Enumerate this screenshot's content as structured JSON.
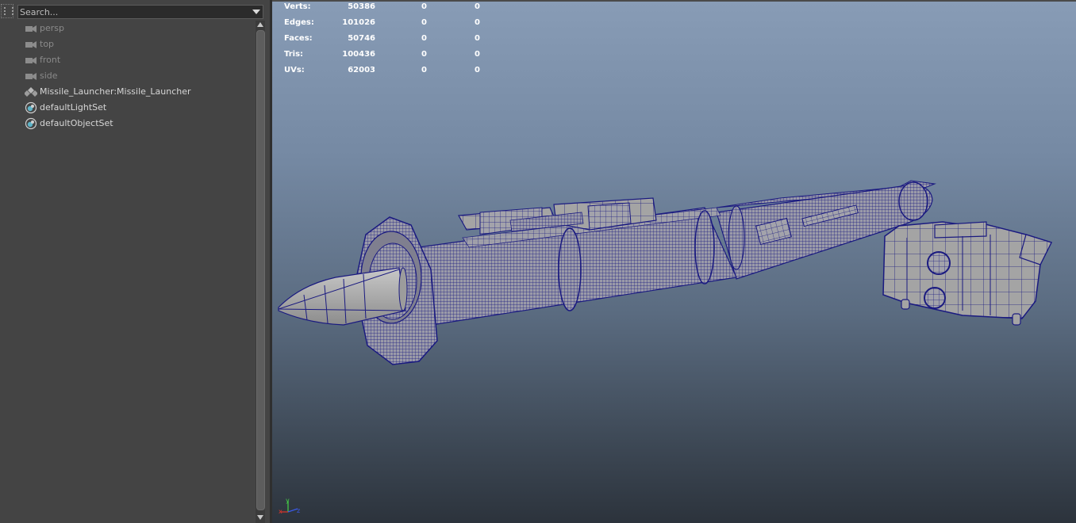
{
  "outliner": {
    "search_placeholder": "Search...",
    "items": [
      {
        "label": "persp",
        "icon": "camera-icon",
        "dim": true
      },
      {
        "label": "top",
        "icon": "camera-icon",
        "dim": true
      },
      {
        "label": "front",
        "icon": "camera-icon",
        "dim": true
      },
      {
        "label": "side",
        "icon": "camera-icon",
        "dim": true
      },
      {
        "label": "Missile_Launcher:Missile_Launcher",
        "icon": "transform-group-icon",
        "dim": false
      },
      {
        "label": "defaultLightSet",
        "icon": "object-set-icon",
        "dim": false
      },
      {
        "label": "defaultObjectSet",
        "icon": "object-set-icon",
        "dim": false
      }
    ]
  },
  "hud": {
    "rows": [
      {
        "label": "Verts:",
        "c1": "50386",
        "c2": "0",
        "c3": "0"
      },
      {
        "label": "Edges:",
        "c1": "101026",
        "c2": "0",
        "c3": "0"
      },
      {
        "label": "Faces:",
        "c1": "50746",
        "c2": "0",
        "c3": "0"
      },
      {
        "label": "Tris:",
        "c1": "100436",
        "c2": "0",
        "c3": "0"
      },
      {
        "label": "UVs:",
        "c1": "62003",
        "c2": "0",
        "c3": "0"
      }
    ]
  },
  "axis": {
    "x": "x",
    "y": "y",
    "z": "z"
  },
  "colors": {
    "wireframe": "#1a1a80",
    "mesh_fill": "#9a9a9a",
    "axis_x": "#e0342a",
    "axis_y": "#45d345",
    "axis_z": "#3a5ae8"
  }
}
